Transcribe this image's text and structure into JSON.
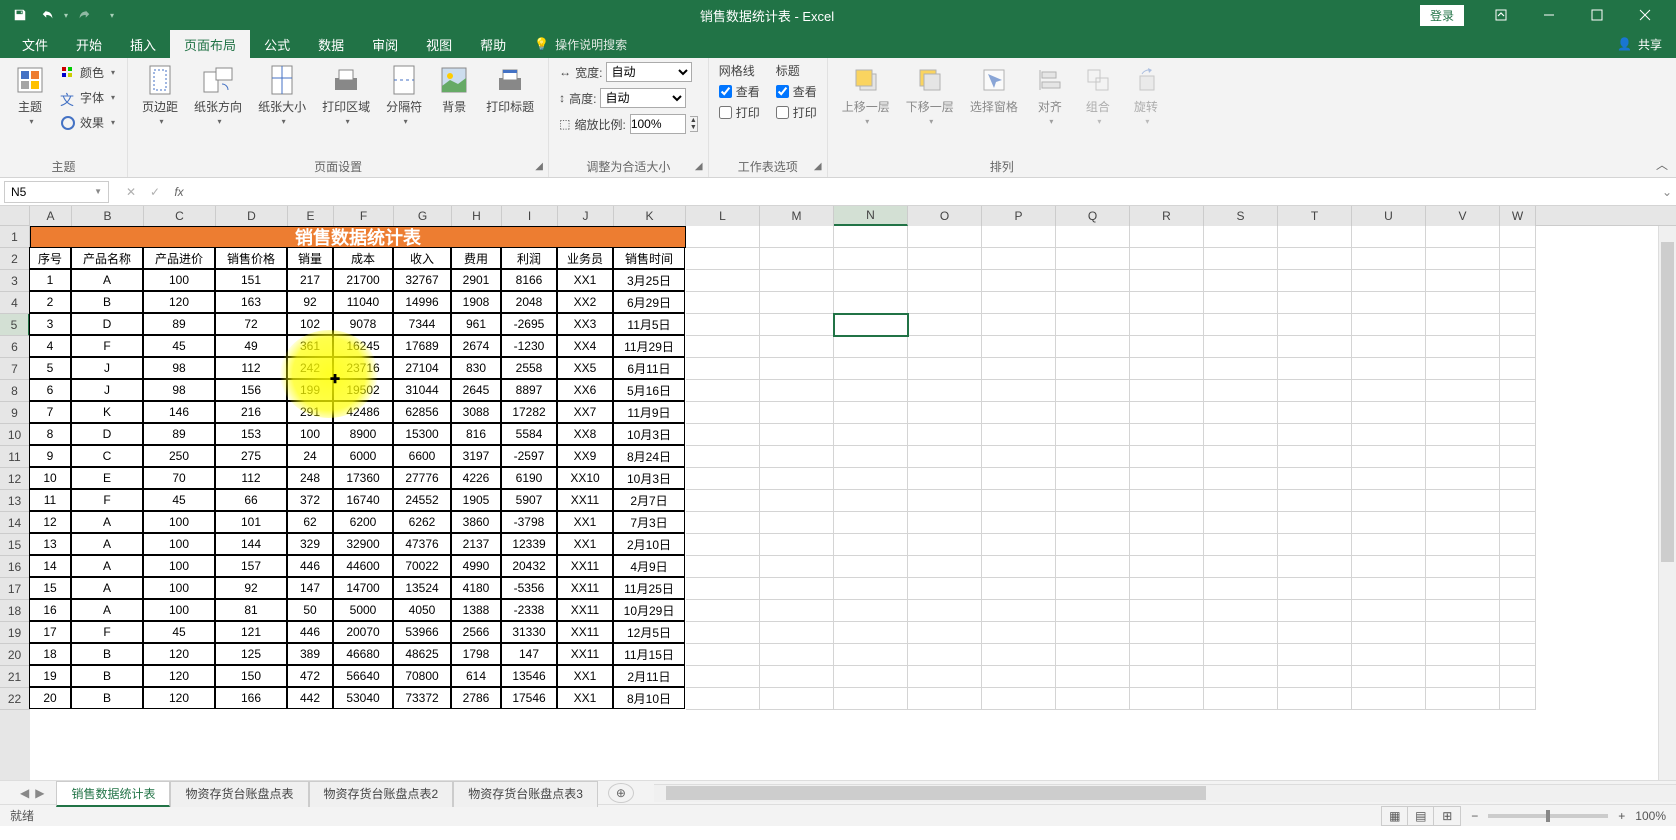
{
  "app": {
    "title": "销售数据统计表 - Excel",
    "login": "登录"
  },
  "qat": {
    "save": "save",
    "undo": "undo",
    "redo": "redo"
  },
  "tabs": [
    "文件",
    "开始",
    "插入",
    "页面布局",
    "公式",
    "数据",
    "审阅",
    "视图",
    "帮助"
  ],
  "active_tab": 3,
  "tell_me": "操作说明搜索",
  "share": "共享",
  "ribbon": {
    "g_theme": {
      "label": "主题",
      "btn": "主题",
      "colors": "颜色",
      "fonts": "字体",
      "effects": "效果"
    },
    "g_page": {
      "label": "页面设置",
      "margins": "页边距",
      "orient": "纸张方向",
      "size": "纸张大小",
      "area": "打印区域",
      "breaks": "分隔符",
      "bg": "背景",
      "titles": "打印标题"
    },
    "g_scale": {
      "label": "调整为合适大小",
      "width": "宽度:",
      "height": "高度:",
      "scale": "缩放比例:",
      "auto": "自动",
      "pct": "100%"
    },
    "g_sheet": {
      "label": "工作表选项",
      "grid": "网格线",
      "head": "标题",
      "view": "查看",
      "print": "打印"
    },
    "g_arrange": {
      "label": "排列",
      "front": "上移一层",
      "back": "下移一层",
      "pane": "选择窗格",
      "align": "对齐",
      "group": "组合",
      "rotate": "旋转"
    }
  },
  "name_box": "N5",
  "formula": "",
  "colw": {
    "A": 42,
    "B": 72,
    "C": 72,
    "D": 72,
    "E": 46,
    "F": 60,
    "G": 58,
    "H": 50,
    "I": 56,
    "J": 56,
    "K": 72,
    "L": 74,
    "M": 74,
    "N": 74,
    "O": 74,
    "P": 74,
    "Q": 74,
    "R": 74,
    "S": 74,
    "T": 74,
    "U": 74,
    "V": 74,
    "W": 36
  },
  "cols": [
    "A",
    "B",
    "C",
    "D",
    "E",
    "F",
    "G",
    "H",
    "I",
    "J",
    "K",
    "L",
    "M",
    "N",
    "O",
    "P",
    "Q",
    "R",
    "S",
    "T",
    "U",
    "V",
    "W"
  ],
  "selected_col": "N",
  "selected_row": 5,
  "title_cell": "销售数据统计表",
  "headers": [
    "序号",
    "产品名称",
    "产品进价",
    "销售价格",
    "销量",
    "成本",
    "收入",
    "费用",
    "利润",
    "业务员",
    "销售时间"
  ],
  "rows": [
    [
      1,
      "A",
      100,
      151,
      217,
      21700,
      32767,
      2901,
      8166,
      "XX1",
      "3月25日"
    ],
    [
      2,
      "B",
      120,
      163,
      92,
      11040,
      14996,
      1908,
      2048,
      "XX2",
      "6月29日"
    ],
    [
      3,
      "D",
      89,
      72,
      102,
      9078,
      7344,
      961,
      -2695,
      "XX3",
      "11月5日"
    ],
    [
      4,
      "F",
      45,
      49,
      361,
      16245,
      17689,
      2674,
      -1230,
      "XX4",
      "11月29日"
    ],
    [
      5,
      "J",
      98,
      112,
      242,
      23716,
      27104,
      830,
      2558,
      "XX5",
      "6月11日"
    ],
    [
      6,
      "J",
      98,
      156,
      199,
      19502,
      31044,
      2645,
      8897,
      "XX6",
      "5月16日"
    ],
    [
      7,
      "K",
      146,
      216,
      291,
      42486,
      62856,
      3088,
      17282,
      "XX7",
      "11月9日"
    ],
    [
      8,
      "D",
      89,
      153,
      100,
      8900,
      15300,
      816,
      5584,
      "XX8",
      "10月3日"
    ],
    [
      9,
      "C",
      250,
      275,
      24,
      6000,
      6600,
      3197,
      -2597,
      "XX9",
      "8月24日"
    ],
    [
      10,
      "E",
      70,
      112,
      248,
      17360,
      27776,
      4226,
      6190,
      "XX10",
      "10月3日"
    ],
    [
      11,
      "F",
      45,
      66,
      372,
      16740,
      24552,
      1905,
      5907,
      "XX11",
      "2月7日"
    ],
    [
      12,
      "A",
      100,
      101,
      62,
      6200,
      6262,
      3860,
      -3798,
      "XX1",
      "7月3日"
    ],
    [
      13,
      "A",
      100,
      144,
      329,
      32900,
      47376,
      2137,
      12339,
      "XX1",
      "2月10日"
    ],
    [
      14,
      "A",
      100,
      157,
      446,
      44600,
      70022,
      4990,
      20432,
      "XX11",
      "4月9日"
    ],
    [
      15,
      "A",
      100,
      92,
      147,
      14700,
      13524,
      4180,
      -5356,
      "XX11",
      "11月25日"
    ],
    [
      16,
      "A",
      100,
      81,
      50,
      5000,
      4050,
      1388,
      -2338,
      "XX11",
      "10月29日"
    ],
    [
      17,
      "F",
      45,
      121,
      446,
      20070,
      53966,
      2566,
      31330,
      "XX11",
      "12月5日"
    ],
    [
      18,
      "B",
      120,
      125,
      389,
      46680,
      48625,
      1798,
      147,
      "XX11",
      "11月15日"
    ],
    [
      19,
      "B",
      120,
      150,
      472,
      56640,
      70800,
      614,
      13546,
      "XX1",
      "2月11日"
    ],
    [
      20,
      "B",
      120,
      166,
      442,
      53040,
      73372,
      2786,
      17546,
      "XX1",
      "8月10日"
    ]
  ],
  "sheets": [
    "销售数据统计表",
    "物资存货台账盘点表",
    "物资存货台账盘点表2",
    "物资存货台账盘点表3"
  ],
  "active_sheet": 0,
  "status": "就绪",
  "zoom": "100%"
}
